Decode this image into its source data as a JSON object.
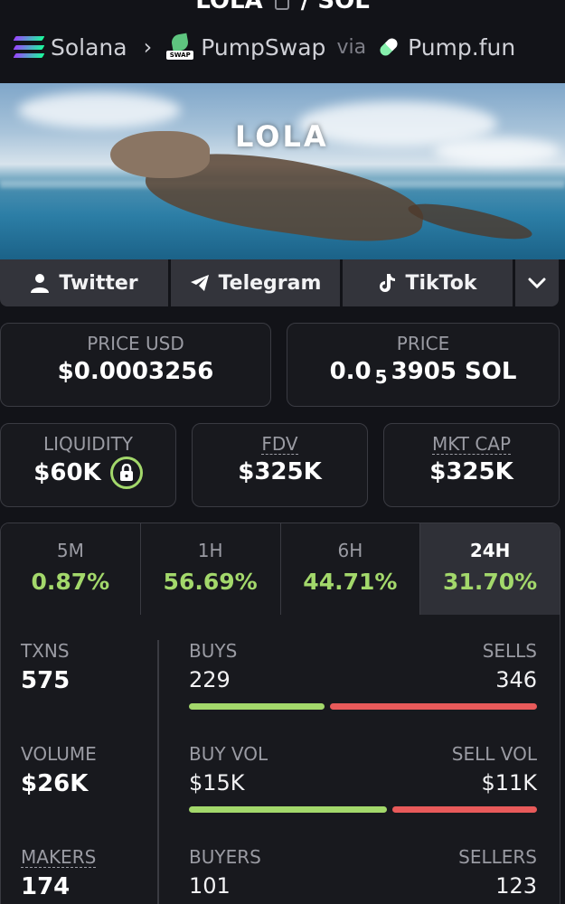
{
  "header": {
    "token": "LOLA",
    "separator": "/",
    "quote": "SOL",
    "chain": "Solana",
    "dex": "PumpSwap",
    "dex_badge": "SWAP",
    "via": "via",
    "launchpad": "Pump.fun"
  },
  "banner": {
    "text": "LOLA"
  },
  "socials": {
    "twitter": "Twitter",
    "telegram": "Telegram",
    "tiktok": "TikTok"
  },
  "price": {
    "usd_label": "PRICE USD",
    "usd_value": "$0.0003256",
    "native_label": "PRICE",
    "native_prefix": "0.0",
    "native_zeros": "5",
    "native_digits": "3905 SOL"
  },
  "metrics": {
    "liquidity_label": "LIQUIDITY",
    "liquidity_value": "$60K",
    "fdv_label": "FDV",
    "fdv_value": "$325K",
    "mcap_label": "MKT CAP",
    "mcap_value": "$325K"
  },
  "timeframes": [
    {
      "label": "5M",
      "change": "0.87%"
    },
    {
      "label": "1H",
      "change": "56.69%"
    },
    {
      "label": "6H",
      "change": "44.71%"
    },
    {
      "label": "24H",
      "change": "31.70%"
    }
  ],
  "txns": {
    "txns_label": "TXNS",
    "txns_value": "575",
    "buys_label": "BUYS",
    "buys_value": "229",
    "sells_label": "SELLS",
    "sells_value": "346",
    "volume_label": "VOLUME",
    "volume_value": "$26K",
    "buy_vol_label": "BUY VOL",
    "buy_vol_value": "$15K",
    "sell_vol_label": "SELL VOL",
    "sell_vol_value": "$11K",
    "makers_label": "MAKERS",
    "makers_value": "174",
    "buyers_label": "BUYERS",
    "buyers_value": "101",
    "sellers_label": "SELLERS",
    "sellers_value": "123"
  },
  "colors": {
    "positive": "#a3d86b",
    "negative": "#e85a5a",
    "panel": "#18191e"
  }
}
